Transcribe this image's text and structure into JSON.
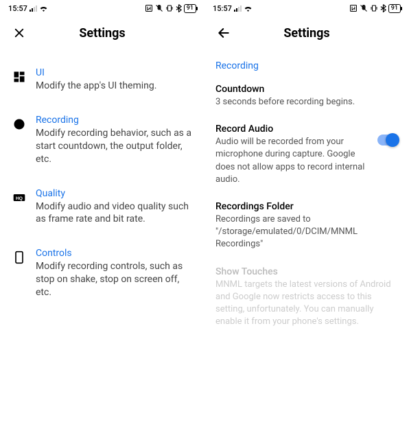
{
  "status": {
    "time": "15:57",
    "battery": "91"
  },
  "left": {
    "title": "Settings",
    "items": [
      {
        "title": "UI",
        "desc": "Modify the app's UI theming."
      },
      {
        "title": "Recording",
        "desc": "Modify recording behavior, such as a start countdown, the output folder, etc."
      },
      {
        "title": "Quality",
        "desc": "Modify audio and video quality such as frame rate and bit rate."
      },
      {
        "title": "Controls",
        "desc": "Modify recording controls, such as stop on shake, stop on screen off, etc."
      }
    ]
  },
  "right": {
    "title": "Settings",
    "section": "Recording",
    "settings": [
      {
        "title": "Countdown",
        "desc": "3 seconds before recording begins."
      },
      {
        "title": "Record Audio",
        "desc": "Audio will be recorded from your microphone during capture. Google does not allow apps to record internal audio."
      },
      {
        "title": "Recordings Folder",
        "desc": "Recordings are saved to \"/storage/emulated/0/DCIM/MNML Recordings\""
      },
      {
        "title": "Show Touches",
        "desc": "MNML targets the latest versions of Android and Google now restricts access to this setting, unfortunately. You can manually enable it from your phone's settings."
      }
    ]
  }
}
